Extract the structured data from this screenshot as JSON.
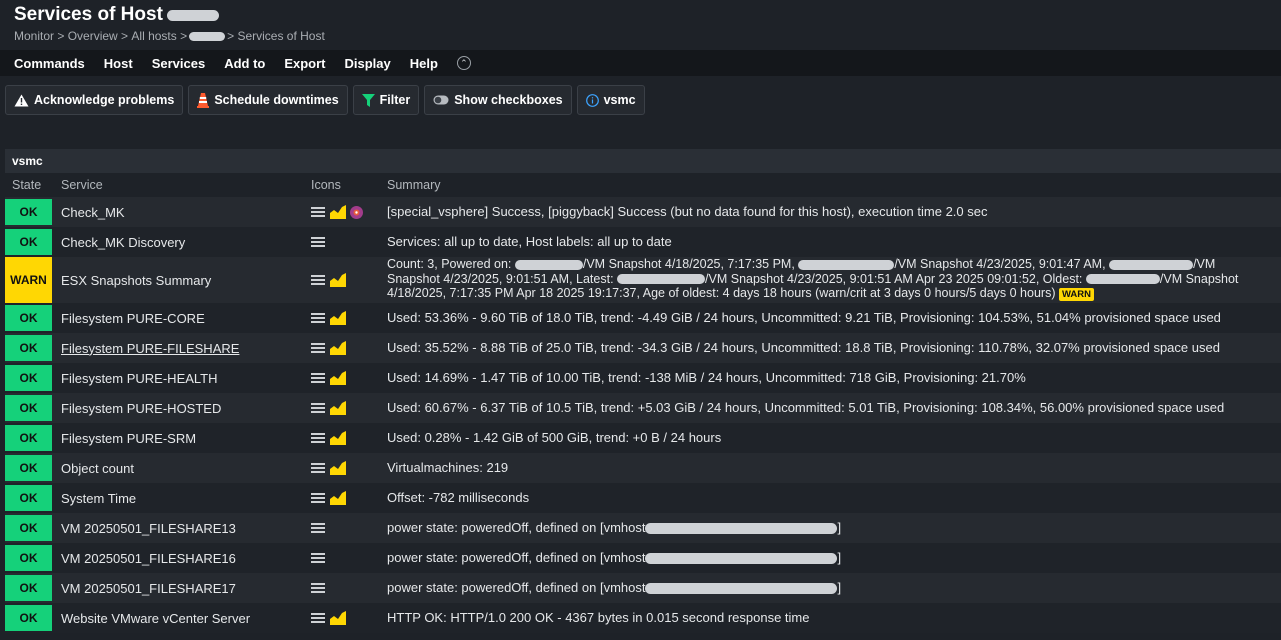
{
  "page": {
    "title": "Services of Host",
    "breadcrumb": [
      "Monitor",
      "Overview",
      "All hosts",
      "Services of Host"
    ]
  },
  "menu": [
    "Commands",
    "Host",
    "Services",
    "Add to",
    "Export",
    "Display",
    "Help"
  ],
  "toolbar": {
    "acknowledge": "Acknowledge problems",
    "downtimes": "Schedule downtimes",
    "filter": "Filter",
    "checkboxes": "Show checkboxes",
    "site": "vsmc"
  },
  "group": "vsmc",
  "columns": {
    "state": "State",
    "service": "Service",
    "icons": "Icons",
    "summary": "Summary"
  },
  "rows": [
    {
      "state": "OK",
      "service": "Check_MK",
      "summary": "[special_vsphere] Success, [piggyback] Success (but no data found for this host), execution time 2.0 sec"
    },
    {
      "state": "OK",
      "service": "Check_MK Discovery",
      "summary": "Services: all up to date, Host labels: all up to date"
    },
    {
      "state": "WARN",
      "service": "ESX Snapshots Summary",
      "summary_lines": [
        "Count: 3, Powered on:",
        "/VM Snapshot 4/18/2025, 7:17:35 PM,",
        "/VM Snapshot 4/23/2025, 9:01:47 AM,",
        "/VM",
        "Snapshot 4/23/2025, 9:01:51 AM, Latest:",
        "/VM Snapshot 4/23/2025, 9:01:51 AM Apr 23 2025 09:01:52, Oldest:",
        "/VM Snapshot",
        "4/18/2025, 7:17:35 PM Apr 18 2025 19:17:37, Age of oldest: 4 days 18 hours (warn/crit at 3 days 0 hours/5 days 0 hours)"
      ],
      "badge": "WARN"
    },
    {
      "state": "OK",
      "service": "Filesystem PURE-CORE",
      "summary": "Used: 53.36% - 9.60 TiB of 18.0 TiB, trend: -4.49 GiB / 24 hours, Uncommitted: 9.21 TiB, Provisioning: 104.53%, 51.04% provisioned space used"
    },
    {
      "state": "OK",
      "service": "Filesystem PURE-FILESHARE",
      "summary": "Used: 35.52% - 8.88 TiB of 25.0 TiB, trend: -34.3 GiB / 24 hours, Uncommitted: 18.8 TiB, Provisioning: 110.78%, 32.07% provisioned space used"
    },
    {
      "state": "OK",
      "service": "Filesystem PURE-HEALTH",
      "summary": "Used: 14.69% - 1.47 TiB of 10.00 TiB, trend: -138 MiB / 24 hours, Uncommitted: 718 GiB, Provisioning: 21.70%"
    },
    {
      "state": "OK",
      "service": "Filesystem PURE-HOSTED",
      "summary": "Used: 60.67% - 6.37 TiB of 10.5 TiB, trend: +5.03 GiB / 24 hours, Uncommitted: 5.01 TiB, Provisioning: 108.34%, 56.00% provisioned space used"
    },
    {
      "state": "OK",
      "service": "Filesystem PURE-SRM",
      "summary": "Used: 0.28% - 1.42 GiB of 500 GiB, trend: +0 B / 24 hours"
    },
    {
      "state": "OK",
      "service": "Object count",
      "summary": "Virtualmachines: 219"
    },
    {
      "state": "OK",
      "service": "System Time",
      "summary": "Offset: -782 milliseconds"
    },
    {
      "state": "OK",
      "service": "VM 20250501_FILESHARE13",
      "summary_pre": "power state: poweredOff, defined on [vmhost",
      "summary_post": "]"
    },
    {
      "state": "OK",
      "service": "VM 20250501_FILESHARE16",
      "summary_pre": "power state: poweredOff, defined on [vmhost",
      "summary_post": "]"
    },
    {
      "state": "OK",
      "service": "VM 20250501_FILESHARE17",
      "summary_pre": "power state: poweredOff, defined on [vmhost",
      "summary_post": "]"
    },
    {
      "state": "OK",
      "service": "Website VMware vCenter Server",
      "summary": "HTTP OK: HTTP/1.0 200 OK - 4367 bytes in 0.015 second response time"
    }
  ],
  "colors": {
    "ok": "#15d17a",
    "warn": "#ffd703",
    "bg": "#1e2228"
  }
}
